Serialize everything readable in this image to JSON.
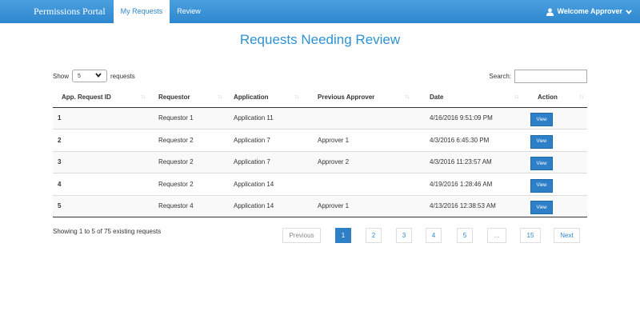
{
  "navbar": {
    "brand": "Permissions Portal",
    "links": [
      {
        "label": "My Requests",
        "active": true
      },
      {
        "label": "Review",
        "active": false
      }
    ],
    "welcome": "Welcome Approver"
  },
  "page": {
    "title": "Requests Needing Review"
  },
  "controls": {
    "show_label": "Show",
    "page_size": "5",
    "requests_label": "requests",
    "search_label": "Search:",
    "search_value": ""
  },
  "table": {
    "columns": [
      "App. Request ID",
      "Requestor",
      "Application",
      "Previous Approver",
      "Date",
      "Action"
    ],
    "rows": [
      {
        "id": "1",
        "requestor": "Requestor 1",
        "application": "Application 11",
        "previous_approver": "",
        "date": "4/16/2016 9:51:09 PM",
        "action": "View"
      },
      {
        "id": "2",
        "requestor": "Requestor 2",
        "application": "Application 7",
        "previous_approver": "Approver 1",
        "date": "4/3/2016 6:45:30 PM",
        "action": "View"
      },
      {
        "id": "3",
        "requestor": "Requestor 2",
        "application": "Application 7",
        "previous_approver": "Approver 2",
        "date": "4/3/2016 11:23:57 AM",
        "action": "View"
      },
      {
        "id": "4",
        "requestor": "Requestor 2",
        "application": "Application 14",
        "previous_approver": "",
        "date": "4/19/2016 1:28:46 AM",
        "action": "View"
      },
      {
        "id": "5",
        "requestor": "Requestor 4",
        "application": "Application 14",
        "previous_approver": "Approver 1",
        "date": "4/13/2016 12:38:53 AM",
        "action": "View"
      }
    ]
  },
  "footer": {
    "info": "Showing 1 to 5 of 75 existing requests",
    "pagination": {
      "previous": "Previous",
      "pages": [
        "1",
        "2",
        "3",
        "4",
        "5",
        "...",
        "15"
      ],
      "next": "Next",
      "current": "1"
    }
  },
  "colors": {
    "accent": "#2e86cf",
    "title": "#2e91d2",
    "button": "#2d7fc7"
  }
}
